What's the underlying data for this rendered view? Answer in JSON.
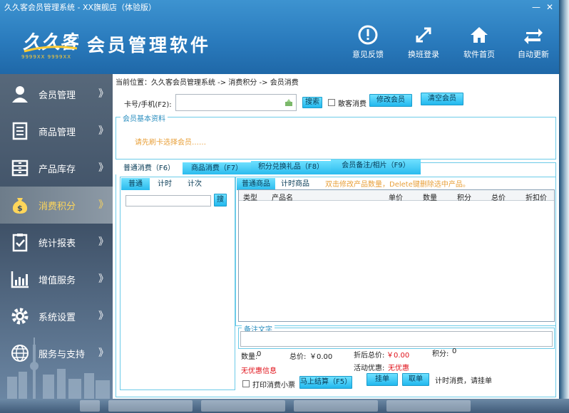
{
  "window": {
    "title": "久久客会员管理系统 - XX旗舰店（体验版）",
    "min_label": "—",
    "close_label": "✕"
  },
  "header": {
    "logo_text": "久久客",
    "logo_sub": "9999XX  9999XX",
    "app_title": "会员管理软件",
    "buttons": [
      {
        "label": "意见反馈",
        "icon": "feedback-icon"
      },
      {
        "label": "换班登录",
        "icon": "switch-shift-icon"
      },
      {
        "label": "软件首页",
        "icon": "home-icon"
      },
      {
        "label": "自动更新",
        "icon": "update-icon"
      }
    ]
  },
  "sidebar": {
    "items": [
      {
        "label": "会员管理",
        "icon": "member-icon",
        "arrow": "》"
      },
      {
        "label": "商品管理",
        "icon": "goods-icon",
        "arrow": "》"
      },
      {
        "label": "产品库存",
        "icon": "inventory-icon",
        "arrow": "》"
      },
      {
        "label": "消费积分",
        "icon": "money-bag-icon",
        "arrow": "》",
        "active": true
      },
      {
        "label": "统计报表",
        "icon": "report-icon",
        "arrow": "》"
      },
      {
        "label": "增值服务",
        "icon": "chart-icon",
        "arrow": "》"
      },
      {
        "label": "系统设置",
        "icon": "gear-icon",
        "arrow": "》"
      },
      {
        "label": "服务与支持",
        "icon": "globe-icon",
        "arrow": "》"
      }
    ]
  },
  "main": {
    "breadcrumb": "当前位置：久久客会员管理系统 -> 消费积分 -> 会员消费",
    "card_label": "卡号/手机(F2):",
    "card_value": "",
    "search_button": "搜索",
    "guest_label": "散客消费",
    "edit_member_button": "修改会员",
    "clear_member_button": "清空会员",
    "member_group_title": "会员基本资料",
    "member_hint": "请先刷卡选择会员……",
    "tabs": [
      "普通消费（F6）",
      "商品消费（F7）",
      "积分兑换礼品（F8）",
      "会员备注/相片（F9）"
    ],
    "left_tabs": [
      "普通",
      "计时",
      "计次"
    ],
    "left_search_button": "搜",
    "right_tabs": [
      "普通商品",
      "计时商品"
    ],
    "right_hint": "双击修改产品数量，Delete键删除选中产品。",
    "table_headers": [
      "类型",
      "产品名",
      "单价",
      "数量",
      "积分",
      "总价",
      "折扣价"
    ],
    "remark_title": "备注文字",
    "stats": {
      "qty_label": "数量:",
      "qty_value": "0",
      "total_label": "总价:",
      "total_value": "￥0.00",
      "discounted_label": "折后总价:",
      "discounted_value": "￥0.00",
      "points_label": "积分:",
      "points_value": "0",
      "promo_label": "无优惠信息",
      "activity_label": "活动优惠:",
      "activity_value": "无优惠"
    },
    "print_label": "打印消费小票",
    "checkout_button": "马上结算（F5）",
    "hang_button": "挂单",
    "take_button": "取单",
    "hang_note": "计时消费，请挂单"
  },
  "colors": {
    "accent": "#22b8ee",
    "header": "#2a7bbd",
    "sidebar": "#3e5066",
    "warning": "#e8a03a",
    "alert": "#e0121a"
  }
}
